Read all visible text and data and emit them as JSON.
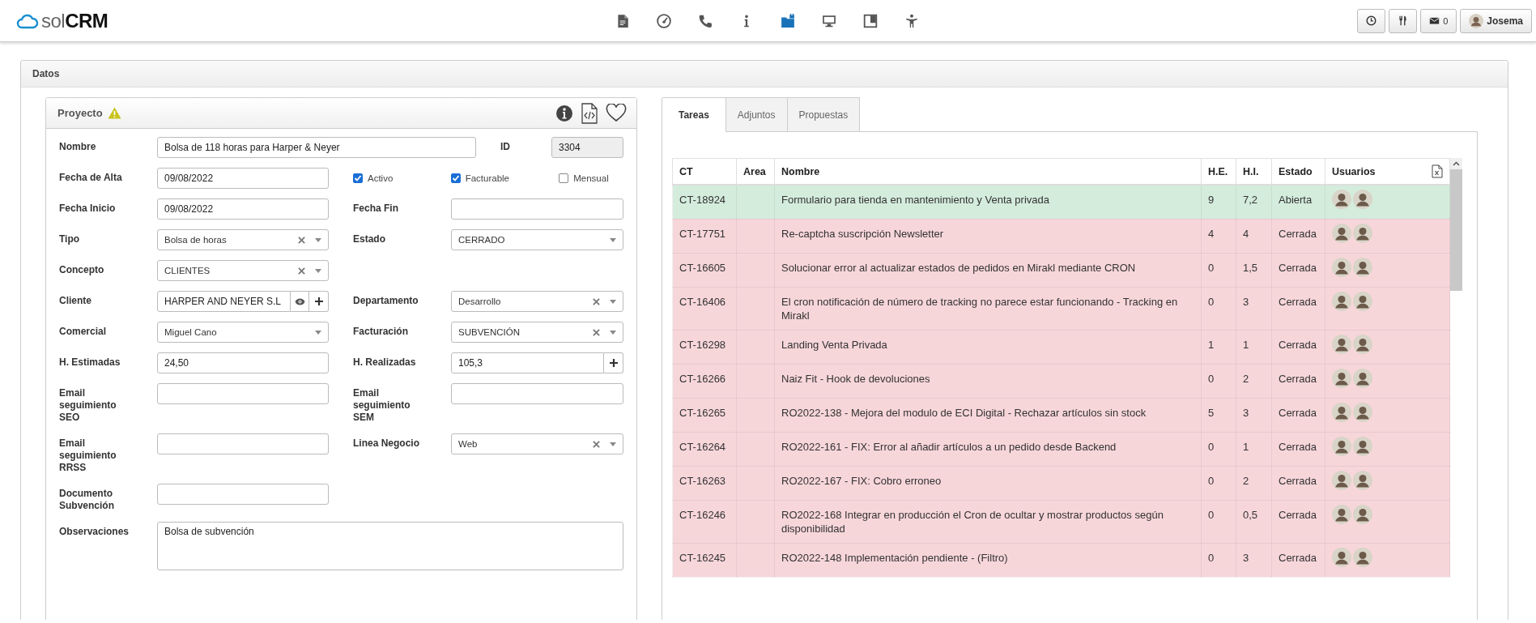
{
  "topbar": {
    "logo": {
      "light": "sol",
      "bold": "CRM"
    },
    "nav": [
      {
        "kind": "document",
        "selected": false
      },
      {
        "kind": "gauge",
        "selected": false
      },
      {
        "kind": "phone",
        "selected": false
      },
      {
        "kind": "info",
        "selected": false
      },
      {
        "kind": "folder",
        "selected": true
      },
      {
        "kind": "monitor",
        "selected": false
      },
      {
        "kind": "board",
        "selected": false
      },
      {
        "kind": "person",
        "selected": false
      }
    ],
    "actions": [
      {
        "kind": "clock"
      },
      {
        "kind": "utensils"
      },
      {
        "kind": "mail",
        "label": "0"
      },
      {
        "kind": "user",
        "label": "Josema"
      }
    ]
  },
  "panel": {
    "title": "Datos"
  },
  "project": {
    "title": "Proyecto",
    "warning": true,
    "rows": [
      {
        "cells": [
          {
            "kind": "wide_text",
            "label": "Nombre",
            "value": "Bolsa de 118 horas para Harper & Neyer"
          },
          {
            "kind": "readonly",
            "label": "ID",
            "value": "3304"
          }
        ]
      },
      {
        "cells": [
          {
            "kind": "text",
            "label": "Fecha de Alta",
            "value": "09/08/2022"
          },
          {
            "kind": "checks",
            "items": [
              {
                "label": "Activo",
                "checked": true
              },
              {
                "label": "Facturable",
                "checked": true
              },
              {
                "label": "Mensual",
                "checked": false
              }
            ]
          }
        ]
      },
      {
        "cells": [
          {
            "kind": "text",
            "label": "Fecha Inicio",
            "value": "09/08/2022"
          },
          {
            "kind": "text",
            "label": "Fecha Fin"
          }
        ]
      },
      {
        "cells": [
          {
            "kind": "select",
            "label": "Tipo",
            "value": "Bolsa de horas",
            "clearable": true
          },
          {
            "kind": "select",
            "label": "Estado",
            "value": "CERRADO",
            "clearable": false
          }
        ]
      },
      {
        "cells": [
          {
            "kind": "select",
            "label": "Concepto",
            "value": "CLIENTES",
            "clearable": true
          }
        ]
      },
      {
        "cells": [
          {
            "kind": "client",
            "label": "Cliente",
            "value": "HARPER AND NEYER S.L"
          },
          {
            "kind": "select",
            "label": "Departamento",
            "value": "Desarrollo",
            "clearable": true
          }
        ]
      },
      {
        "cells": [
          {
            "kind": "select",
            "label": "Comercial",
            "value": "Miguel Cano",
            "clearable": false
          },
          {
            "kind": "select",
            "label": "Facturación",
            "value": "SUBVENCIÓN",
            "clearable": true
          }
        ]
      },
      {
        "cells": [
          {
            "kind": "text",
            "label": "H. Estimadas",
            "value": "24,50"
          },
          {
            "kind": "text_plus",
            "label": "H. Realizadas",
            "value": "105,3"
          }
        ]
      },
      {
        "cells": [
          {
            "kind": "text",
            "label": "Email seguimiento SEO"
          },
          {
            "kind": "text",
            "label": "Email seguimiento SEM"
          }
        ]
      },
      {
        "cells": [
          {
            "kind": "text",
            "label": "Email seguimiento RRSS"
          },
          {
            "kind": "select",
            "label": "Linea Negocio",
            "value": "Web",
            "clearable": true
          }
        ]
      },
      {
        "cells": [
          {
            "kind": "text",
            "label": "Documento Subvención"
          }
        ]
      },
      {
        "cells": [
          {
            "kind": "textarea",
            "label": "Observaciones",
            "value": "Bolsa de subvención"
          }
        ]
      }
    ]
  },
  "tasks": {
    "tabs": [
      {
        "label": "Tareas",
        "selected": true
      },
      {
        "label": "Adjuntos",
        "selected": false
      },
      {
        "label": "Propuestas",
        "selected": false
      }
    ],
    "columns": [
      "CT",
      "Area",
      "Nombre",
      "H.E.",
      "H.I.",
      "Estado",
      "Usuarios"
    ],
    "rows": [
      {
        "ct": "CT-18924",
        "nombre": "Formulario para tienda en mantenimiento y Venta privada",
        "he": "9",
        "hi": "7,2",
        "estado": "Abierta",
        "color": "#d4ecdc"
      },
      {
        "ct": "CT-17751",
        "nombre": "Re-captcha suscripción Newsletter",
        "he": "4",
        "hi": "4",
        "estado": "Cerrada",
        "color": "#f7d6da"
      },
      {
        "ct": "CT-16605",
        "nombre": "Solucionar error al actualizar estados de pedidos en Mirakl mediante CRON",
        "he": "0",
        "hi": "1,5",
        "estado": "Cerrada",
        "color": "#f7d6da"
      },
      {
        "ct": "CT-16406",
        "nombre": "El cron notificación de número de tracking no parece estar funcionando - Tracking en Mirakl",
        "he": "0",
        "hi": "3",
        "estado": "Cerrada",
        "color": "#f7d6da"
      },
      {
        "ct": "CT-16298",
        "nombre": "Landing Venta Privada",
        "he": "1",
        "hi": "1",
        "estado": "Cerrada",
        "color": "#f7d6da"
      },
      {
        "ct": "CT-16266",
        "nombre": "Naiz Fit - Hook de devoluciones",
        "he": "0",
        "hi": "2",
        "estado": "Cerrada",
        "color": "#f7d6da"
      },
      {
        "ct": "CT-16265",
        "nombre": "RO2022-138 - Mejora del modulo de ECI Digital - Rechazar artículos sin stock",
        "he": "5",
        "hi": "3",
        "estado": "Cerrada",
        "color": "#f7d6da"
      },
      {
        "ct": "CT-16264",
        "nombre": "RO2022-161 - FIX: Error al añadir artículos a un pedido desde Backend",
        "he": "0",
        "hi": "1",
        "estado": "Cerrada",
        "color": "#f7d6da"
      },
      {
        "ct": "CT-16263",
        "nombre": "RO2022-167 - FIX: Cobro erroneo",
        "he": "0",
        "hi": "2",
        "estado": "Cerrada",
        "color": "#f7d6da"
      },
      {
        "ct": "CT-16246",
        "nombre": "RO2022-168 Integrar en producción el Cron de ocultar y mostrar productos según disponibilidad",
        "he": "0",
        "hi": "0,5",
        "estado": "Cerrada",
        "color": "#f7d6da"
      },
      {
        "ct": "CT-16245",
        "nombre": "RO2022-148 Implementación pendiente - (Filtro)",
        "he": "0",
        "hi": "3",
        "estado": "Cerrada",
        "color": "#f7d6da"
      }
    ]
  }
}
